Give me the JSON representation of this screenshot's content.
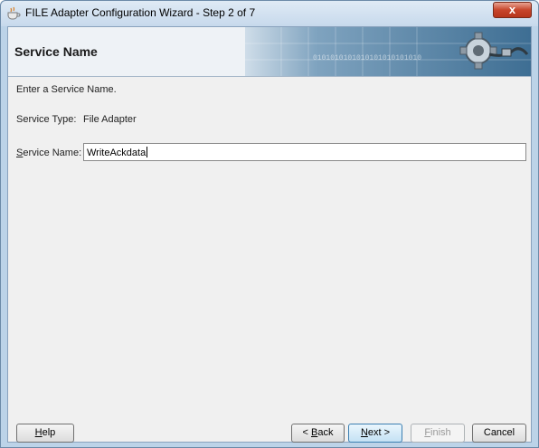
{
  "window": {
    "title": "FILE Adapter Configuration Wizard - Step 2 of 7",
    "close_glyph": "x"
  },
  "banner": {
    "title": "Service Name",
    "art_text": "0101010101010101010101010",
    "art_icon": "gear-plug-icon"
  },
  "content": {
    "instruction": "Enter a Service Name.",
    "service_type_label": "Service Type:",
    "service_type_value": "File Adapter",
    "service_name_label_mnemonic": "S",
    "service_name_label_rest": "ervice Name:",
    "service_name_value": "WriteAckdata"
  },
  "buttons": {
    "help": {
      "mnemonic": "H",
      "rest": "elp"
    },
    "back": {
      "prefix": "< ",
      "mnemonic": "B",
      "rest": "ack"
    },
    "next": {
      "mnemonic": "N",
      "rest": "ext >"
    },
    "finish": {
      "mnemonic": "F",
      "rest": "inish"
    },
    "cancel": {
      "label": "Cancel"
    }
  }
}
